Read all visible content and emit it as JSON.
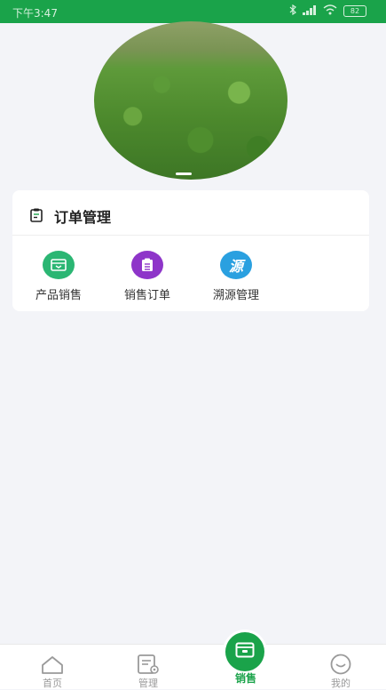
{
  "status_bar": {
    "time": "下午3:47",
    "battery": "82"
  },
  "card": {
    "title": "订单管理",
    "actions": [
      {
        "label": "产品销售",
        "icon": "box-icon",
        "color": "#2bb673"
      },
      {
        "label": "销售订单",
        "icon": "clipboard-icon",
        "color": "#8e35c9"
      },
      {
        "label": "溯源管理",
        "icon": "trace-icon",
        "color": "#2aa0e0",
        "glyph": "源"
      }
    ]
  },
  "tabbar": {
    "items": [
      {
        "label": "首页",
        "icon": "home-icon",
        "active": false
      },
      {
        "label": "管理",
        "icon": "manage-icon",
        "active": false
      },
      {
        "label": "销售",
        "icon": "sales-box-icon",
        "active": true
      },
      {
        "label": "我的",
        "icon": "smile-icon",
        "active": false
      }
    ],
    "active_color": "#1aa34a",
    "inactive_color": "#9a9a9a"
  }
}
